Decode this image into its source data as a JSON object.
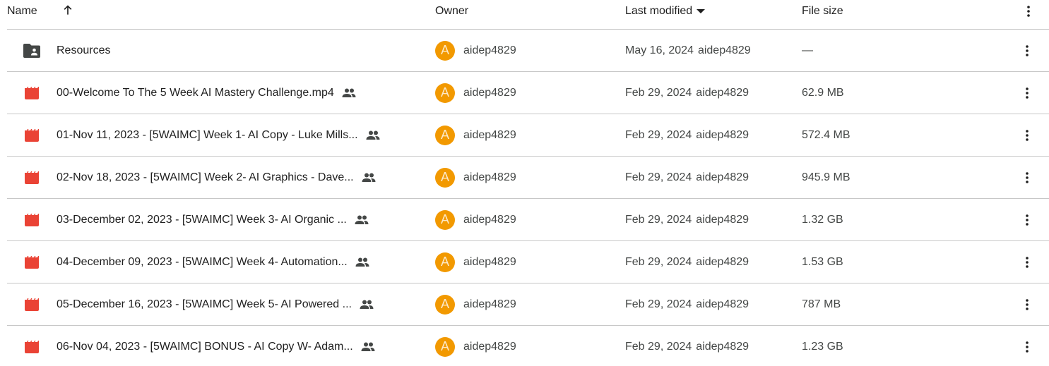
{
  "columns": {
    "name": "Name",
    "owner": "Owner",
    "last_modified": "Last modified",
    "file_size": "File size"
  },
  "icons": {
    "sort_name": "arrow-up-icon",
    "sort_modified": "caret-down-icon",
    "more": "more-vert-icon",
    "folder": "shared-folder-icon",
    "video": "video-file-icon",
    "shared": "people-icon"
  },
  "colors": {
    "avatar": "#f29900",
    "video_icon": "#ea4335",
    "folder_icon": "#444746",
    "divider": "#c7c7c7"
  },
  "rows": [
    {
      "type": "folder",
      "name": "Resources",
      "shared": false,
      "owner_initial": "A",
      "owner": "aidep4829",
      "modified_date": "May 16, 2024",
      "modified_by": "aidep4829",
      "size": "—"
    },
    {
      "type": "video",
      "name": "00-Welcome To The 5 Week AI Mastery Challenge.mp4",
      "shared": true,
      "owner_initial": "A",
      "owner": "aidep4829",
      "modified_date": "Feb 29, 2024",
      "modified_by": "aidep4829",
      "size": "62.9 MB"
    },
    {
      "type": "video",
      "name": "01-Nov 11, 2023 - [5WAIMC] Week 1- AI Copy - Luke Mills...",
      "shared": true,
      "owner_initial": "A",
      "owner": "aidep4829",
      "modified_date": "Feb 29, 2024",
      "modified_by": "aidep4829",
      "size": "572.4 MB"
    },
    {
      "type": "video",
      "name": "02-Nov 18, 2023 - [5WAIMC] Week 2- AI Graphics - Dave...",
      "shared": true,
      "owner_initial": "A",
      "owner": "aidep4829",
      "modified_date": "Feb 29, 2024",
      "modified_by": "aidep4829",
      "size": "945.9 MB"
    },
    {
      "type": "video",
      "name": "03-December 02, 2023 - [5WAIMC] Week 3- AI Organic ...",
      "shared": true,
      "owner_initial": "A",
      "owner": "aidep4829",
      "modified_date": "Feb 29, 2024",
      "modified_by": "aidep4829",
      "size": "1.32 GB"
    },
    {
      "type": "video",
      "name": "04-December 09, 2023 - [5WAIMC] Week 4- Automation...",
      "shared": true,
      "owner_initial": "A",
      "owner": "aidep4829",
      "modified_date": "Feb 29, 2024",
      "modified_by": "aidep4829",
      "size": "1.53 GB"
    },
    {
      "type": "video",
      "name": "05-December 16, 2023 - [5WAIMC] Week 5- AI Powered ...",
      "shared": true,
      "owner_initial": "A",
      "owner": "aidep4829",
      "modified_date": "Feb 29, 2024",
      "modified_by": "aidep4829",
      "size": "787 MB"
    },
    {
      "type": "video",
      "name": "06-Nov 04, 2023 - [5WAIMC] BONUS - AI Copy W- Adam...",
      "shared": true,
      "owner_initial": "A",
      "owner": "aidep4829",
      "modified_date": "Feb 29, 2024",
      "modified_by": "aidep4829",
      "size": "1.23 GB"
    }
  ]
}
